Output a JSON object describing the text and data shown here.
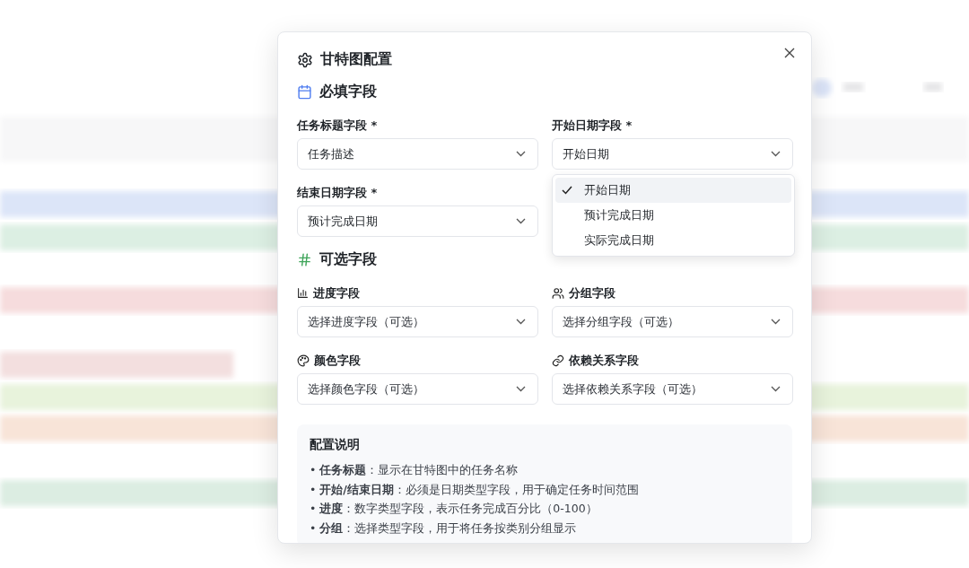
{
  "dialog": {
    "title": "甘特图配置",
    "required_section": {
      "title": "必填字段",
      "fields": [
        {
          "label": "任务标题字段 *",
          "value": "任务描述"
        },
        {
          "label": "开始日期字段 *",
          "value": "开始日期",
          "options": [
            {
              "label": "开始日期",
              "selected": true
            },
            {
              "label": "预计完成日期",
              "selected": false
            },
            {
              "label": "实际完成日期",
              "selected": false
            }
          ]
        },
        {
          "label": "结束日期字段 *",
          "value": "预计完成日期"
        }
      ]
    },
    "optional_section": {
      "title": "可选字段",
      "fields": [
        {
          "label": "进度字段",
          "kind": "progress",
          "placeholder": "选择进度字段（可选）"
        },
        {
          "label": "分组字段",
          "kind": "group",
          "placeholder": "选择分组字段（可选）"
        },
        {
          "label": "颜色字段",
          "kind": "color",
          "placeholder": "选择颜色字段（可选）"
        },
        {
          "label": "依赖关系字段",
          "kind": "dependency",
          "placeholder": "选择依赖关系字段（可选）"
        }
      ]
    },
    "info": {
      "title": "配置说明",
      "items": [
        "• **任务标题**：显示在甘特图中的任务名称",
        "• **开始/结束日期**：必须是日期类型字段，用于确定任务时间范围",
        "• **进度**：数字类型字段，表示任务完成百分比（0-100）",
        "• **分组**：选择类型字段，用于将任务按类别分组显示"
      ]
    }
  }
}
